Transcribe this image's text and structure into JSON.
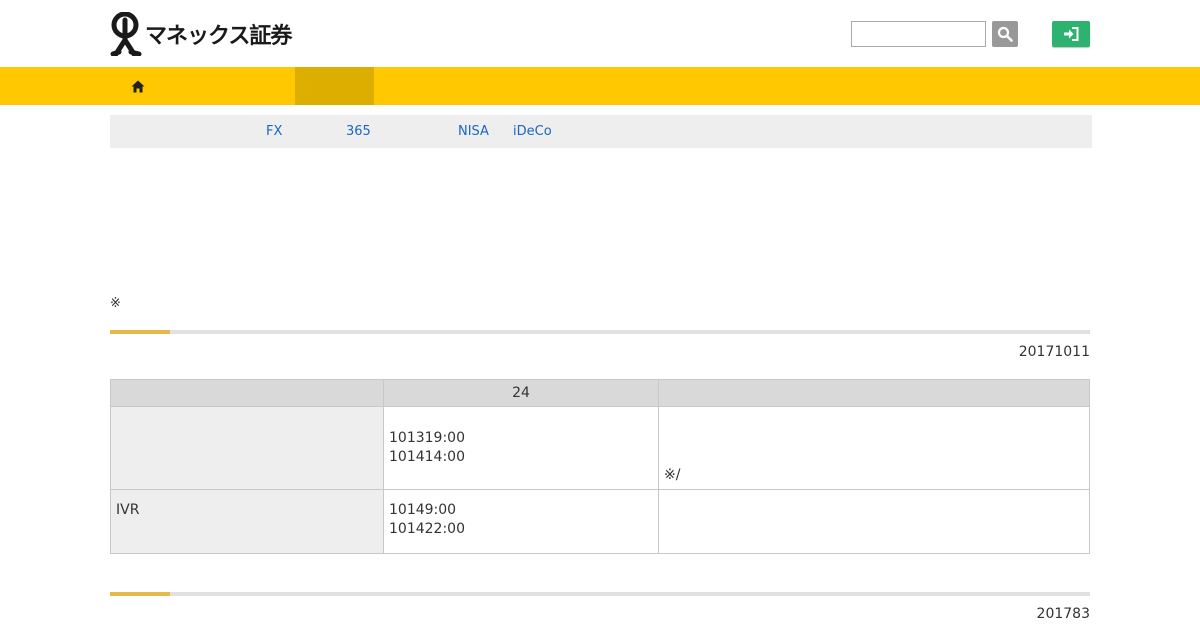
{
  "header": {
    "logo_text": "マネックス証券",
    "search": {
      "placeholder": "",
      "value": ""
    },
    "search_icon": "search-icon",
    "login_icon": "login-icon"
  },
  "nav": {
    "home_icon": "home-icon",
    "bg_color": "#ffc800",
    "active_color": "#dbae00"
  },
  "subnav": {
    "items": [
      "FX",
      "365",
      "NISA",
      "iDeCo"
    ]
  },
  "notice": "※",
  "sections": [
    {
      "date": "20171011"
    },
    {
      "date": "201783"
    }
  ],
  "table": {
    "headers": [
      "",
      "24",
      ""
    ],
    "rows": [
      {
        "label": "",
        "times": [
          "101319:00",
          "101414:00"
        ],
        "note": "※/"
      },
      {
        "label": "IVR",
        "times": [
          "10149:00",
          "101422:00"
        ],
        "note": ""
      }
    ]
  }
}
